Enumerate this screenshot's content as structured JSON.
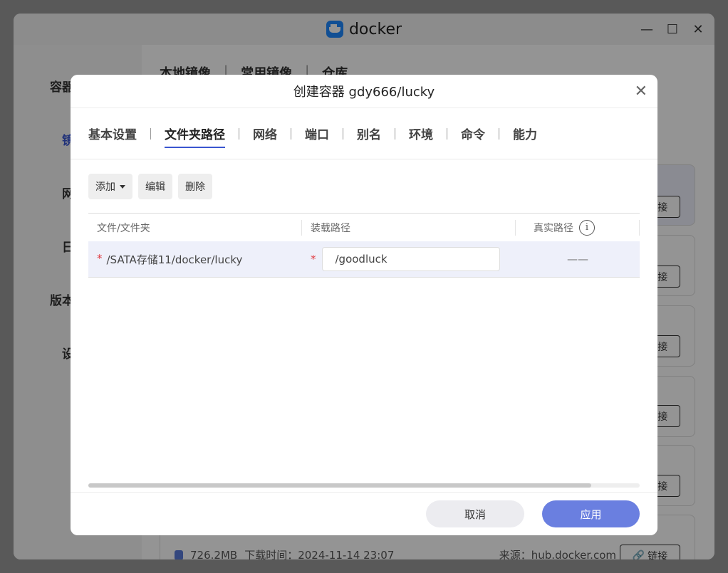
{
  "window": {
    "app_name": "docker",
    "controls": [
      "—",
      "☐",
      "✕"
    ]
  },
  "sidebar": {
    "items": [
      {
        "label": "容器概况"
      },
      {
        "label": "镜"
      },
      {
        "label": "网"
      },
      {
        "label": "日"
      },
      {
        "label": "版本"
      },
      {
        "label": "设"
      }
    ]
  },
  "main": {
    "tabs": [
      "本地镜像",
      "常用镜像",
      "仓库"
    ],
    "card_link_label": "链接",
    "last_card": {
      "size": "726.2MB",
      "download_time": "下载时间：2024-11-14 23:07",
      "source": "来源：hub.docker.com"
    }
  },
  "dialog": {
    "title": "创建容器 gdy666/lucky",
    "close": "✕",
    "tabs": [
      "基本设置",
      "文件夹路径",
      "网络",
      "端口",
      "别名",
      "环境",
      "命令",
      "能力"
    ],
    "active_tab": "文件夹路径",
    "toolbar": {
      "add": "添加",
      "edit": "编辑",
      "delete": "删除"
    },
    "table": {
      "headers": [
        "文件/文件夹",
        "装载路径",
        "真实路径"
      ],
      "info_icon": "i",
      "rows": [
        {
          "required_mark": "*",
          "file": "/SATA存储11/docker/lucky",
          "mount_path": "/goodluck",
          "real_path": "——"
        }
      ]
    },
    "footer": {
      "cancel": "取消",
      "apply": "应用"
    }
  },
  "colors": {
    "accent": "#3a56d0",
    "apply_button": "#6a7fe0",
    "required": "#e0383e"
  }
}
